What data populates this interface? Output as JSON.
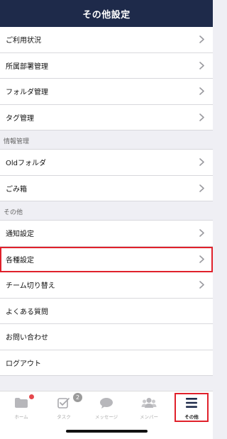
{
  "header": {
    "title": "その他設定"
  },
  "groups": [
    {
      "section_title": "",
      "items": [
        {
          "label": "ご利用状況",
          "chevron": true
        },
        {
          "label": "所属部署管理",
          "chevron": true
        },
        {
          "label": "フォルダ管理",
          "chevron": true
        },
        {
          "label": "タグ管理",
          "chevron": true
        }
      ]
    },
    {
      "section_title": "情報管理",
      "items": [
        {
          "label": "Oldフォルダ",
          "chevron": true
        },
        {
          "label": "ごみ箱",
          "chevron": true
        }
      ]
    },
    {
      "section_title": "その他",
      "items": [
        {
          "label": "通知設定",
          "chevron": true
        },
        {
          "label": "各種設定",
          "chevron": true,
          "highlighted": true
        },
        {
          "label": "チーム切り替え",
          "chevron": true
        },
        {
          "label": "よくある質問",
          "chevron": false
        },
        {
          "label": "お問い合わせ",
          "chevron": false
        },
        {
          "label": "ログアウト",
          "chevron": false
        }
      ]
    }
  ],
  "tabbar": {
    "tabs": [
      {
        "label": "ホーム",
        "icon": "folder-icon",
        "badge_dot": true
      },
      {
        "label": "タスク",
        "icon": "task-check-icon",
        "badge_count": "2"
      },
      {
        "label": "メッセージ",
        "icon": "chat-bubble-icon"
      },
      {
        "label": "メンバー",
        "icon": "members-icon"
      },
      {
        "label": "その他",
        "icon": "hamburger-menu-icon",
        "active": true
      }
    ]
  },
  "colors": {
    "header_bg": "#1e2a4a",
    "highlight": "#e0212b",
    "badge_red": "#e5484d",
    "badge_gray": "#9b9b9b",
    "inactive_tab": "#aaaaaa",
    "active_tab": "#222222"
  }
}
